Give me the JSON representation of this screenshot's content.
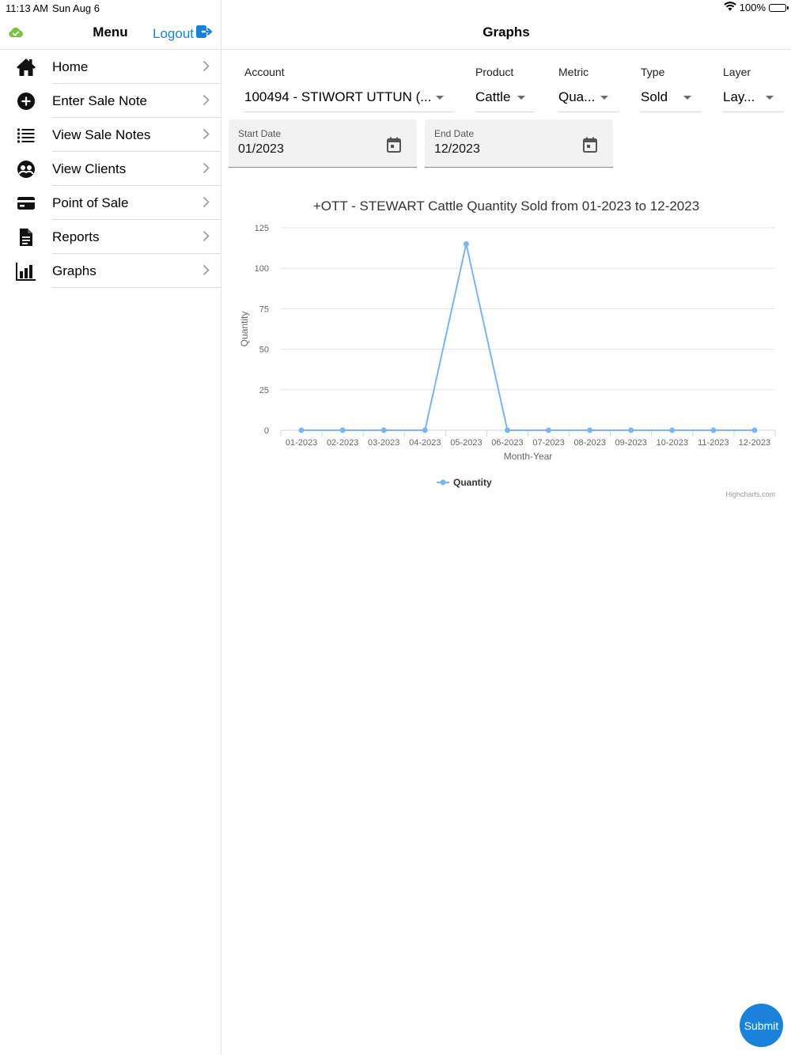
{
  "status_bar": {
    "time": "11:13 AM",
    "date": "Sun Aug 6",
    "battery": "100%"
  },
  "sidebar": {
    "title": "Menu",
    "logout_label": "Logout",
    "items": [
      {
        "label": "Home",
        "icon": "home-icon"
      },
      {
        "label": "Enter Sale Note",
        "icon": "plus-circle-icon"
      },
      {
        "label": "View Sale Notes",
        "icon": "list-icon"
      },
      {
        "label": "View Clients",
        "icon": "clients-icon"
      },
      {
        "label": "Point of Sale",
        "icon": "credit-card-icon"
      },
      {
        "label": "Reports",
        "icon": "document-icon"
      },
      {
        "label": "Graphs",
        "icon": "bar-chart-icon"
      }
    ]
  },
  "main": {
    "title": "Graphs",
    "filters": {
      "account": {
        "label": "Account",
        "value": "100494 - STIWORT UTTUN (..."
      },
      "product": {
        "label": "Product",
        "value": "Cattle"
      },
      "metric": {
        "label": "Metric",
        "value": "Qua..."
      },
      "type": {
        "label": "Type",
        "value": "Sold"
      },
      "layer": {
        "label": "Layer",
        "value": "Lay..."
      }
    },
    "start_date": {
      "label": "Start Date",
      "value": "01/2023"
    },
    "end_date": {
      "label": "End Date",
      "value": "12/2023"
    },
    "credits": "Highcharts.com",
    "submit_label": "Submit"
  },
  "colors": {
    "accent": "#1a82d8",
    "series": "#7cb5ec",
    "cloud": "#7cc242"
  },
  "chart_data": {
    "type": "line",
    "title": "+OTT - STEWART  Cattle Quantity Sold from 01-2023 to 12-2023",
    "xlabel": "Month-Year",
    "ylabel": "Quantity",
    "categories": [
      "01-2023",
      "02-2023",
      "03-2023",
      "04-2023",
      "05-2023",
      "06-2023",
      "07-2023",
      "08-2023",
      "09-2023",
      "10-2023",
      "11-2023",
      "12-2023"
    ],
    "series": [
      {
        "name": "Quantity",
        "values": [
          0,
          0,
          0,
          0,
          115,
          0,
          0,
          0,
          0,
          0,
          0,
          0
        ]
      }
    ],
    "ylim": [
      0,
      125
    ],
    "yticks": [
      0,
      25,
      50,
      75,
      100,
      125
    ],
    "grid": true,
    "legend": "bottom-center"
  }
}
